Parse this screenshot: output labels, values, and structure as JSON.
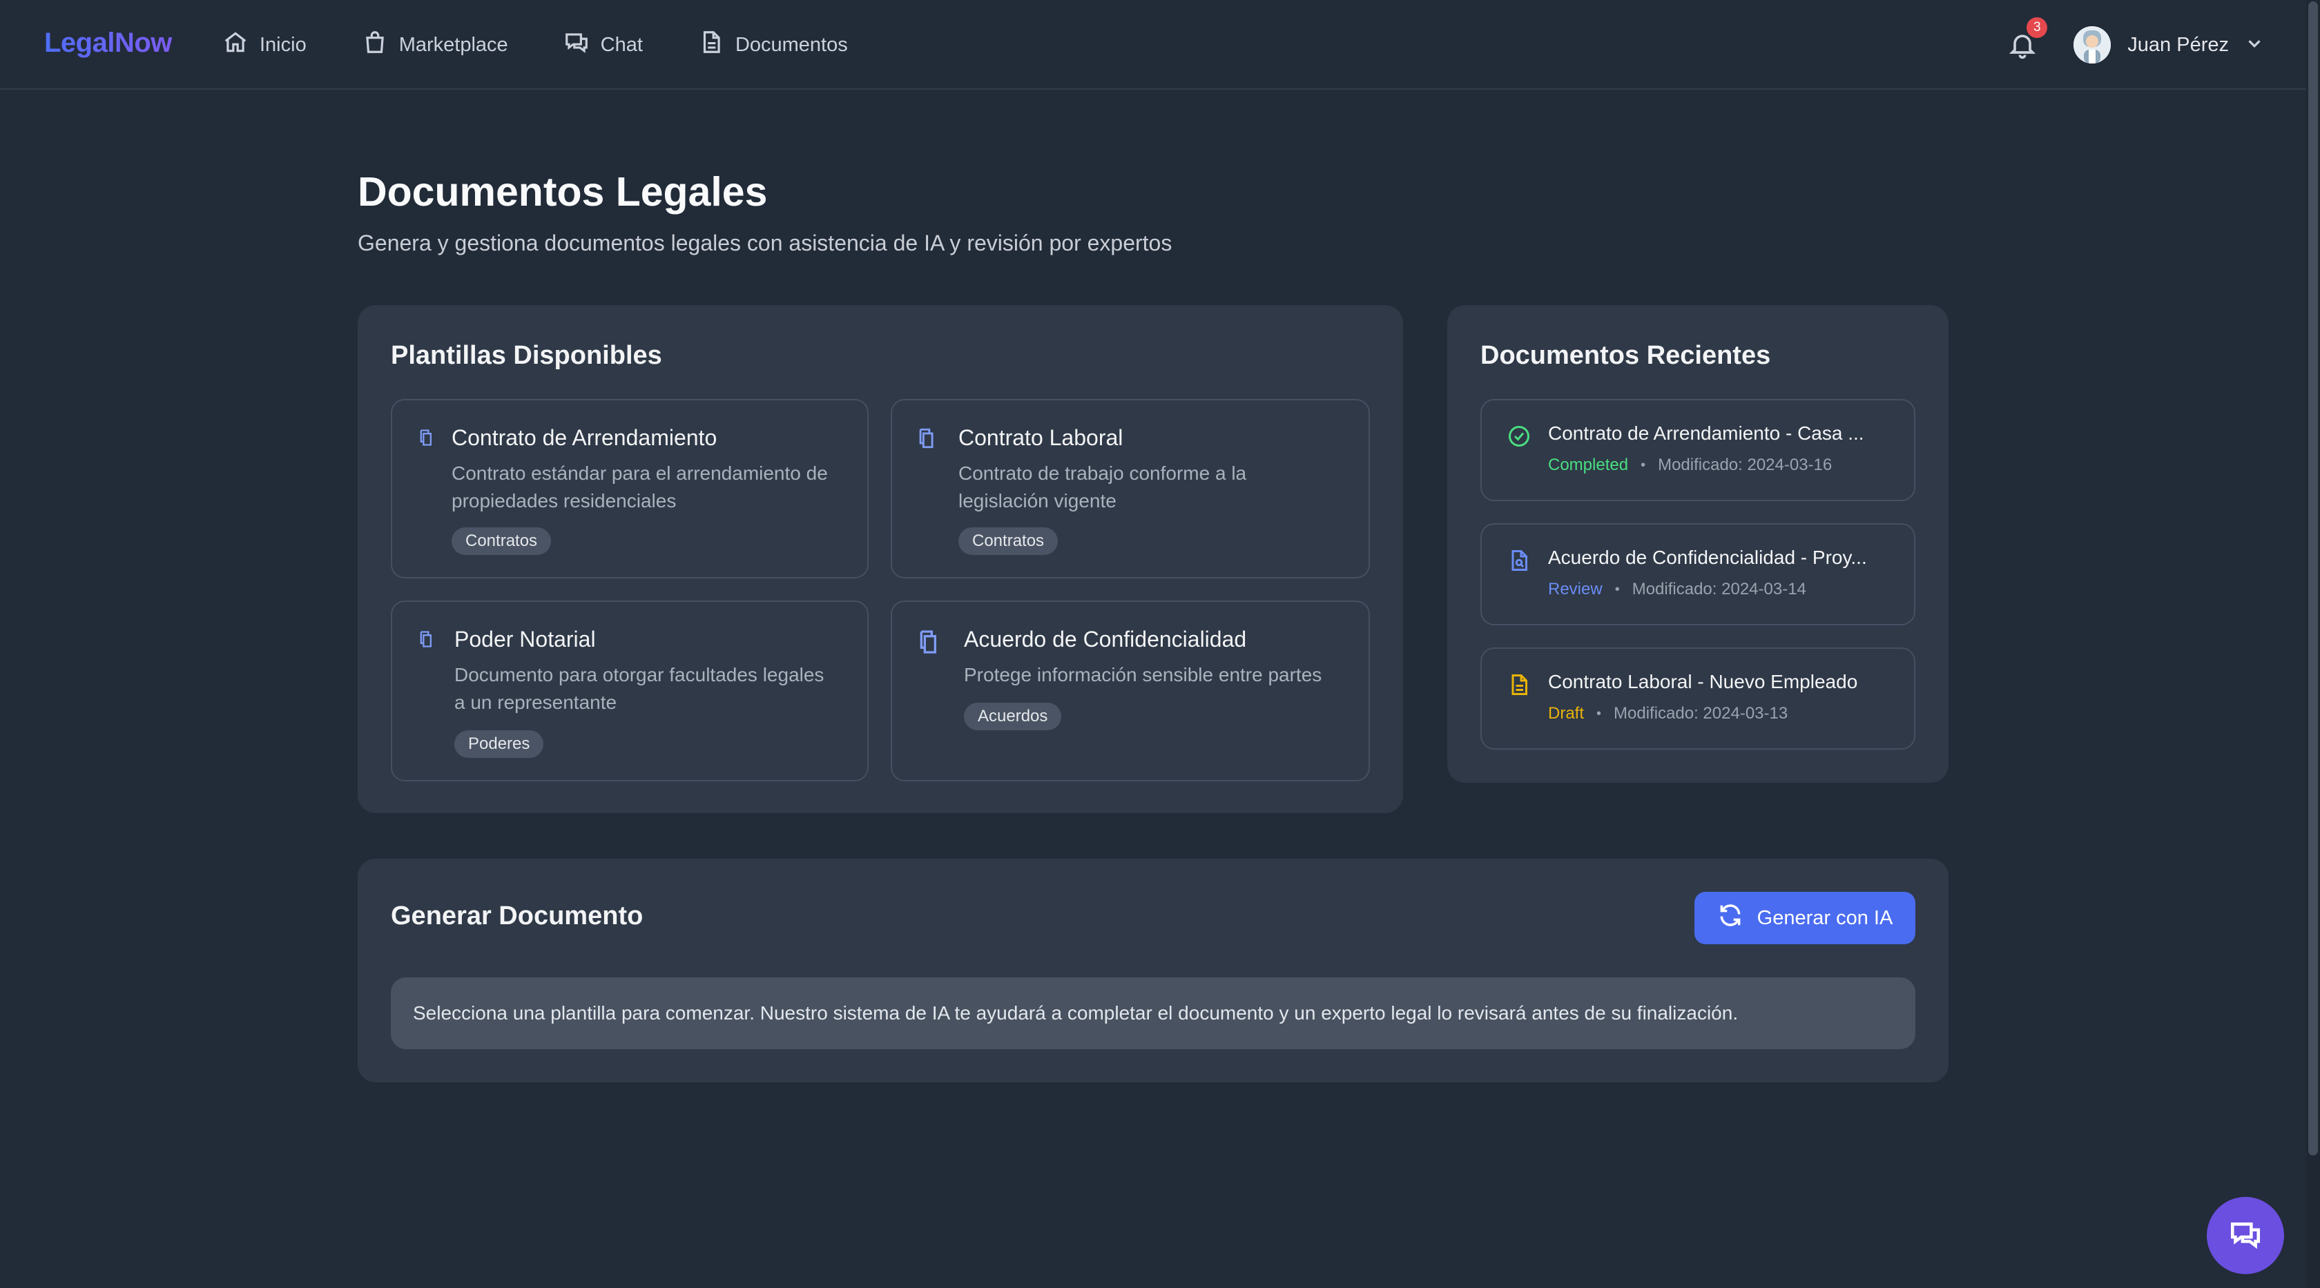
{
  "header": {
    "brand": "LegalNow",
    "nav": [
      {
        "label": "Inicio",
        "icon": "home-icon"
      },
      {
        "label": "Marketplace",
        "icon": "shopping-bag-icon"
      },
      {
        "label": "Chat",
        "icon": "chat-icon"
      },
      {
        "label": "Documentos",
        "icon": "document-icon"
      }
    ],
    "notifications_count": "3",
    "user_name": "Juan Pérez"
  },
  "page": {
    "title": "Documentos Legales",
    "subtitle": "Genera y gestiona documentos legales con asistencia de IA y revisión por expertos"
  },
  "templates": {
    "title": "Plantillas Disponibles",
    "items": [
      {
        "title": "Contrato de Arrendamiento",
        "desc_line1": "Contrato estándar para el arrendamiento de",
        "desc_line2": "propiedades residenciales",
        "tag": "Contratos"
      },
      {
        "title": "Contrato Laboral",
        "desc_line1": "Contrato de trabajo conforme a la",
        "desc_line2": "legislación vigente",
        "tag": "Contratos"
      },
      {
        "title": "Poder Notarial",
        "desc_line1": "Documento para otorgar facultades legales",
        "desc_line2": "a un representante",
        "tag": "Poderes"
      },
      {
        "title": "Acuerdo de Confidencialidad",
        "desc_line1": "Protege información sensible entre partes",
        "desc_line2": "",
        "tag": "Acuerdos"
      }
    ]
  },
  "recent": {
    "title": "Documentos Recientes",
    "items": [
      {
        "title": "Contrato de Arrendamiento - Casa ...",
        "status": "Completed",
        "status_color": "#4ade80",
        "modified": "Modificado: 2024-03-16",
        "icon": "check-circle-icon"
      },
      {
        "title": "Acuerdo de Confidencialidad - Proy...",
        "status": "Review",
        "status_color": "#6b8cf5",
        "modified": "Modificado: 2024-03-14",
        "icon": "document-search-icon"
      },
      {
        "title": "Contrato Laboral - Nuevo Empleado",
        "status": "Draft",
        "status_color": "#eab308",
        "modified": "Modificado: 2024-03-13",
        "icon": "document-text-icon"
      }
    ]
  },
  "generate": {
    "title": "Generar Documento",
    "button_label": "Generar con IA",
    "info": "Selecciona una plantilla para comenzar. Nuestro sistema de IA te ayudará a completar el documento y un experto legal lo revisará antes de su finalización."
  },
  "colors": {
    "background": "#222b38",
    "panel": "#2f3947",
    "accent": "#4a6cf0",
    "fab": "#6a4fe0"
  }
}
